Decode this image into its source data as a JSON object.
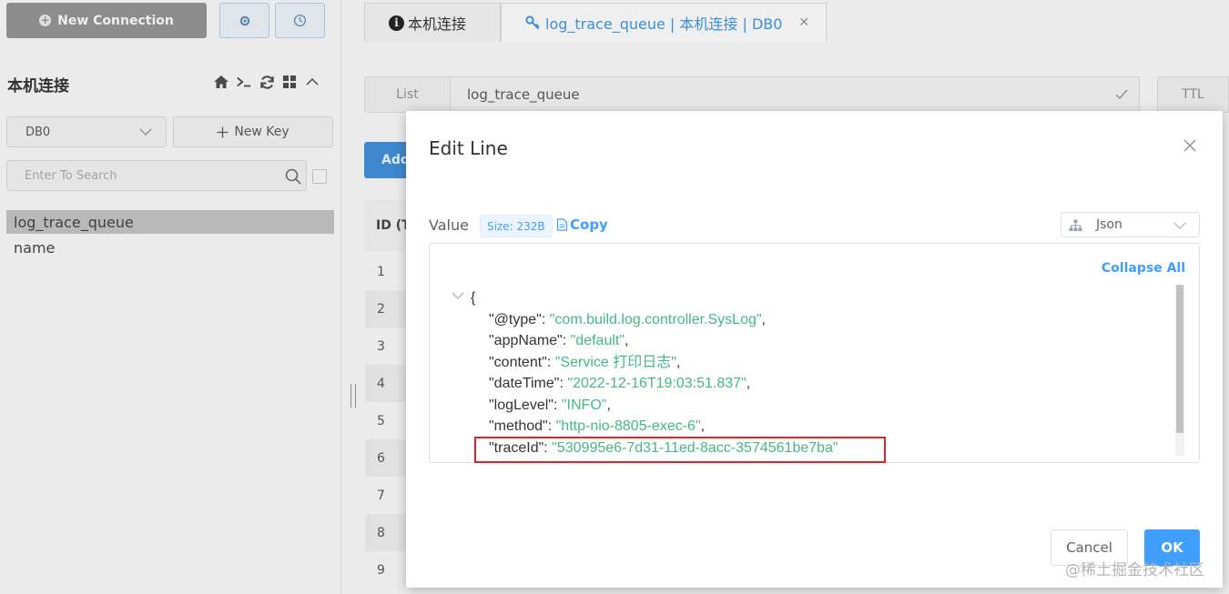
{
  "sidebar": {
    "new_connection_label": "New Connection",
    "connection_name": "本机连接",
    "db_select_value": "DB0",
    "new_key_label": "New Key",
    "search_placeholder": "Enter To Search",
    "keys": [
      "log_trace_queue",
      "name"
    ]
  },
  "tabs": [
    {
      "label": "本机连接"
    },
    {
      "label": "log_trace_queue | 本机连接 | DB0"
    }
  ],
  "key_header": {
    "type": "List",
    "key_name": "log_trace_queue",
    "ttl_label": "TTL",
    "add_label": "Add New Line"
  },
  "table": {
    "id_header": "ID (T",
    "row_ids": [
      "1",
      "2",
      "3",
      "4",
      "5",
      "6",
      "7",
      "8",
      "9"
    ]
  },
  "modal": {
    "title": "Edit Line",
    "value_label": "Value",
    "size_tag": "Size: 232B",
    "copy_label": "Copy",
    "format_value": "Json",
    "collapse_all_label": "Collapse All",
    "cancel_label": "Cancel",
    "ok_label": "OK",
    "json_open": "{",
    "fields": [
      {
        "key": "\"@type\"",
        "value": "\"com.build.log.controller.SysLog\"",
        "trail": ","
      },
      {
        "key": "\"appName\"",
        "value": "\"default\"",
        "trail": ","
      },
      {
        "key": "\"content\"",
        "value": "\"Service 打印日志\"",
        "trail": ","
      },
      {
        "key": "\"dateTime\"",
        "value": "\"2022-12-16T19:03:51.837\"",
        "trail": ","
      },
      {
        "key": "\"logLevel\"",
        "value": "\"INFO\"",
        "trail": ","
      },
      {
        "key": "\"method\"",
        "value": "\"http-nio-8805-exec-6\"",
        "trail": ","
      },
      {
        "key": "\"traceId\"",
        "value": "\"530995e6-7d31-11ed-8acc-3574561be7ba\"",
        "trail": ""
      }
    ]
  },
  "watermark": "@稀土掘金技术社区",
  "colors": {
    "accent": "#409eff",
    "json_string": "#42b983",
    "highlight_box": "#e12323"
  }
}
